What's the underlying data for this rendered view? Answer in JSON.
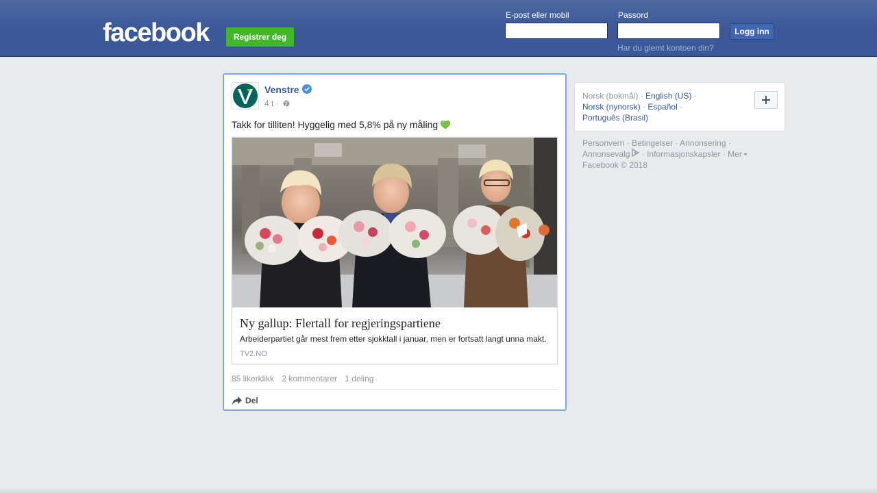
{
  "header": {
    "logo": "facebook",
    "register_label": "Registrer deg",
    "email_label": "E-post eller mobil",
    "password_label": "Passord",
    "email_value": "",
    "password_value": "",
    "login_label": "Logg inn",
    "forgot_label": "Har du glemt kontoen din?"
  },
  "post": {
    "page_name": "Venstre",
    "time": "4 t",
    "separator": "·",
    "text": "Takk for tilliten! Hyggelig med 5,8% på ny måling",
    "link": {
      "title": "Ny gallup: Flertall for regjeringspartiene",
      "description": "Arbeiderpartiet går mest frem etter sjokktall i januar, men er fortsatt langt unna makt.",
      "domain": "TV2.NO"
    },
    "stats": {
      "likes": "85 likerklikk",
      "comments": "2 kommentarer",
      "shares": "1 deling"
    },
    "share_label": "Del"
  },
  "languages": {
    "current": "Norsk (bokmål)",
    "english": "English (US)",
    "nynorsk": "Norsk (nynorsk)",
    "espanol": "Español",
    "portugues": "Português (Brasil)",
    "sep": "·"
  },
  "footer": {
    "privacy": "Personvern",
    "terms": "Betingelser",
    "advertising": "Annonsering",
    "adchoices": "Annonsevalg",
    "cookies": "Informasjonskapsler",
    "more": "Mer",
    "copyright": "Facebook © 2018",
    "sep": "·"
  },
  "colors": {
    "header_blue": "#3b5998",
    "register_green": "#42b72a",
    "link_blue": "#365899",
    "post_focus_border": "#7fa6ee"
  },
  "icons": [
    "verified-badge-icon",
    "globe-icon",
    "green-heart-icon",
    "share-arrow-icon",
    "adchoices-icon",
    "plus-icon",
    "caret-down-icon"
  ]
}
